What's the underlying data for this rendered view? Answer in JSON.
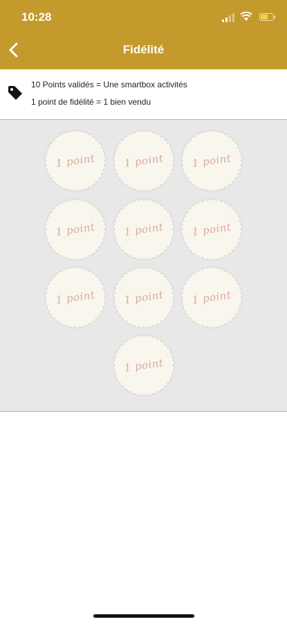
{
  "status_bar": {
    "time": "10:28"
  },
  "header": {
    "title": "Fidélité"
  },
  "info": {
    "line1": "10 Points validés = Une smartbox activités",
    "line2": "1 point de fidélité = 1 bien vendu"
  },
  "stamps": [
    {
      "label": "1 point"
    },
    {
      "label": "1 point"
    },
    {
      "label": "1 point"
    },
    {
      "label": "1 point"
    },
    {
      "label": "1 point"
    },
    {
      "label": "1 point"
    },
    {
      "label": "1 point"
    },
    {
      "label": "1 point"
    },
    {
      "label": "1 point"
    },
    {
      "label": "1 point"
    }
  ],
  "icons": {
    "back": "chevron-left-icon",
    "tag": "tag-icon",
    "signal": "signal-icon",
    "wifi": "wifi-icon",
    "battery": "battery-icon"
  },
  "colors": {
    "brand": "#c49a2c",
    "stamp_fill": "#f9f6ee",
    "stamp_text": "#d8aa9c",
    "area_bg": "#e8e8e8"
  }
}
